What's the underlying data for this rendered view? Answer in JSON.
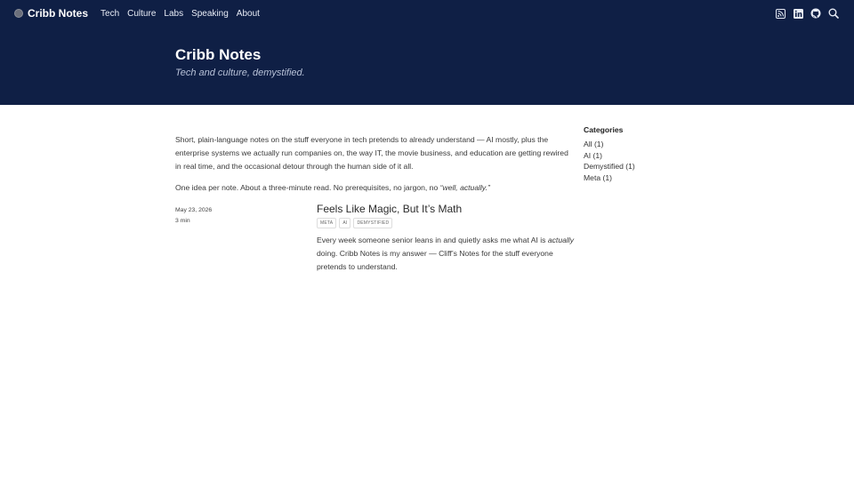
{
  "nav": {
    "brand": "Cribb Notes",
    "links": [
      "Tech",
      "Culture",
      "Labs",
      "Speaking",
      "About"
    ],
    "icons": [
      "rss-icon",
      "linkedin-icon",
      "github-icon",
      "search-icon"
    ]
  },
  "hero": {
    "title": "Cribb Notes",
    "subtitle": "Tech and culture, demystified."
  },
  "intro": {
    "p1": "Short, plain-language notes on the stuff everyone in tech pretends to already understand — AI mostly, plus the enterprise systems we actually run companies on, the way IT, the movie business, and education are getting rewired in real time, and the occasional detour through the human side of it all.",
    "p2_start": "One idea per note. About a three-minute read. No prerequisites, no jargon, no ",
    "p2_em": "“well, actually.”"
  },
  "post": {
    "date": "May 23, 2026",
    "read_time": "3 min",
    "title": "Feels Like Magic, But It’s Math",
    "tags": [
      "META",
      "AI",
      "DEMYSTIFIED"
    ],
    "desc_start": "Every week someone senior leans in and quietly asks me what AI is ",
    "desc_em": "actually",
    "desc_end": " doing. Cribb Notes is my answer — Cliff’s Notes for the stuff everyone pretends to understand."
  },
  "sidebar": {
    "title": "Categories",
    "categories": [
      "All (1)",
      "AI (1)",
      "Demystified (1)",
      "Meta (1)"
    ]
  },
  "colors": {
    "header_bg": "#0f1f45"
  }
}
